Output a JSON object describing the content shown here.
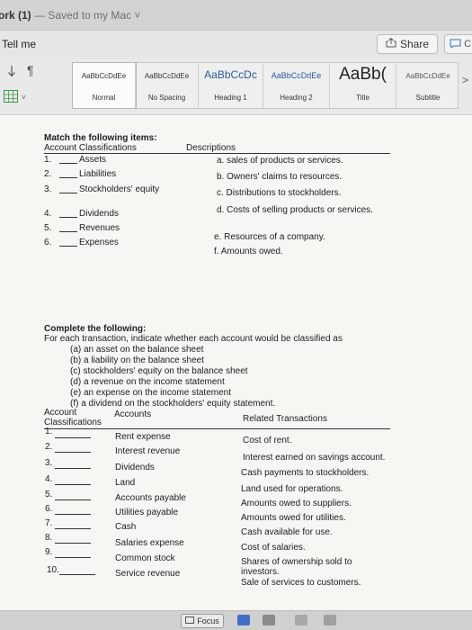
{
  "window": {
    "doc_name": "ork (1)",
    "separator": " — ",
    "saved_status": "Saved to my Mac",
    "chevron": "˅"
  },
  "toolbar": {
    "tell_me": "Tell me",
    "share_label": "Share",
    "comments_label": "C"
  },
  "ribbon": {
    "styles": [
      {
        "sample": "AaBbCcDdEe",
        "name": "Normal"
      },
      {
        "sample": "AaBbCcDdEe",
        "name": "No Spacing"
      },
      {
        "sample": "AaBbCcDc",
        "name": "Heading 1"
      },
      {
        "sample": "AaBbCcDdEe",
        "name": "Heading 2"
      },
      {
        "sample": "AaBb(",
        "name": "Title"
      },
      {
        "sample": "AaBbCcDdEe",
        "name": "Subtitle"
      }
    ],
    "more": ">"
  },
  "document": {
    "match": {
      "heading": "Match the following items:",
      "col_left": "Account Classifications",
      "col_right": "Descriptions",
      "items": [
        {
          "num": "1.",
          "label": "Assets"
        },
        {
          "num": "2.",
          "label": "Liabilities"
        },
        {
          "num": "3.",
          "label": "Stockholders' equity"
        },
        {
          "num": "4.",
          "label": "Dividends"
        },
        {
          "num": "5.",
          "label": "Revenues"
        },
        {
          "num": "6.",
          "label": "Expenses"
        }
      ],
      "descriptions": [
        "a. sales of products or services.",
        "b. Owners' claims to resources.",
        "c. Distributions to stockholders.",
        "d. Costs of selling products or services.",
        "e. Resources of a company.",
        "f. Amounts owed."
      ]
    },
    "complete": {
      "heading": "Complete the following:",
      "instruction": "For each transaction, indicate whether each account would be classified as",
      "options": [
        "(a) an asset on the balance sheet",
        "(b) a liability on the balance sheet",
        "(c) stockholders' equity on the balance sheet",
        "(d) a revenue on the income statement",
        "(e) an expense on the income statement",
        "(f) a dividend on the stockholders' equity statement."
      ],
      "col_account": "Account",
      "col_classifications": "Classifications",
      "col_accounts": "Accounts",
      "col_related": "Related Transactions",
      "rows": [
        {
          "num": "1.",
          "account": "Rent expense",
          "transaction": "Cost of rent."
        },
        {
          "num": "2.",
          "account": "Interest revenue",
          "transaction": "Interest earned on savings account."
        },
        {
          "num": "3.",
          "account": "Dividends",
          "transaction": "Cash payments to stockholders."
        },
        {
          "num": "4.",
          "account": "Land",
          "transaction": "Land used for operations."
        },
        {
          "num": "5.",
          "account": "Accounts payable",
          "transaction": "Amounts owed to suppliers."
        },
        {
          "num": "6.",
          "account": "Utilities payable",
          "transaction": "Amounts owed for utilities."
        },
        {
          "num": "7.",
          "account": "Cash",
          "transaction": "Cash available for use."
        },
        {
          "num": "8.",
          "account": "Salaries expense",
          "transaction": "Cost of salaries."
        },
        {
          "num": "9.",
          "account": "Common stock",
          "transaction": "Shares of ownership sold to investors."
        },
        {
          "num": "10.",
          "account": "Service revenue",
          "transaction": "Sale of services to customers."
        }
      ]
    }
  },
  "statusbar": {
    "focus_label": "Focus"
  },
  "icons": {
    "share": "share-icon",
    "comment": "comment-icon",
    "pilcrow": "pilcrow-icon",
    "table": "table-icon",
    "focus": "focus-icon"
  },
  "colors": {
    "accent_blue": "#2b6fd6"
  }
}
